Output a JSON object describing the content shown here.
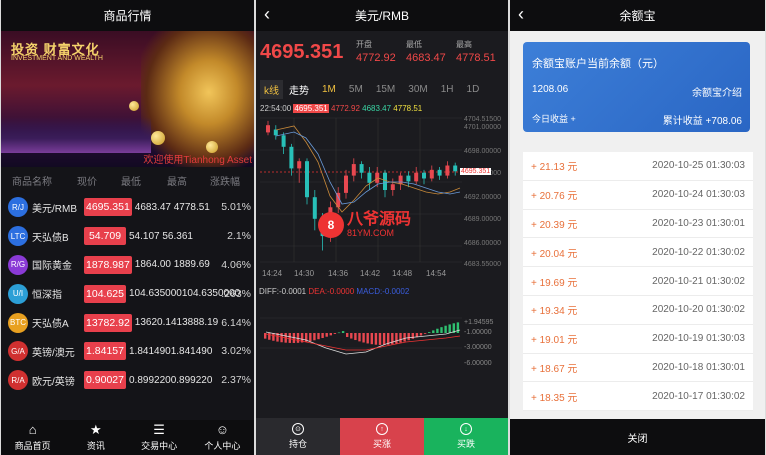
{
  "market": {
    "title": "商品行情",
    "banner": {
      "headline": "投资 财富文化",
      "sub": "INVESTMENT AND WEALTH",
      "welcome": "欢迎使用Tianhong Asset"
    },
    "columns": [
      "商品名称",
      "现价",
      "最低",
      "最高",
      "涨跌幅"
    ],
    "rows": [
      {
        "badge": "R/J",
        "name": "美元/RMB",
        "price": "4695.351",
        "vals": "4683.47 4778.51",
        "pct": "5.01%",
        "color": "#2c6fe0"
      },
      {
        "badge": "LTC",
        "name": "天弘债B",
        "price": "54.709",
        "vals": "54.107 56.361",
        "pct": "2.1%",
        "color": "#2c6fe0"
      },
      {
        "badge": "R/G",
        "name": "国际黄金",
        "price": "1878.987",
        "vals": "1864.00 1889.69",
        "pct": "4.06%",
        "color": "#8a3ad6"
      },
      {
        "badge": "U/I",
        "name": "恒深指",
        "price": "104.625",
        "vals": "104.635000104.6350000",
        "pct": ".263%",
        "color": "#2c9fd6"
      },
      {
        "badge": "BTC",
        "name": "天弘债A",
        "price": "13782.92",
        "vals": "13620.1413888.19",
        "pct": "6.14%",
        "color": "#e8a020"
      },
      {
        "badge": "G/A",
        "name": "英镑/澳元",
        "price": "1.84157",
        "vals": "1.8414901.841490",
        "pct": "3.02%",
        "color": "#d03030"
      },
      {
        "badge": "R/A",
        "name": "欧元/英镑",
        "price": "0.90027",
        "vals": "0.8992200.899220",
        "pct": "2.37%",
        "color": "#d03030"
      }
    ],
    "tabs": [
      {
        "icon": "⌂",
        "label": "商品首页"
      },
      {
        "icon": "★",
        "label": "资讯"
      },
      {
        "icon": "☰",
        "label": "交易中心"
      },
      {
        "icon": "☺",
        "label": "个人中心"
      }
    ]
  },
  "detail": {
    "title": "美元/RMB",
    "price": "4695.351",
    "open_label": "开盘",
    "open": "4772.92",
    "low_label": "最低",
    "low": "4683.47",
    "high_label": "最高",
    "high": "4778.51",
    "periods": {
      "kline": "k线",
      "trend": "走势",
      "p1": "1M",
      "p2": "5M",
      "p3": "15M",
      "p4": "30M",
      "p5": "1H",
      "p6": "1D"
    },
    "info": {
      "time": "22:54:00",
      "v1": "4695.351",
      "v2": "4772.92",
      "v3": "4683.47",
      "v4": "4778.51"
    },
    "yaxis": [
      "4704.51500",
      "4701.00000",
      "4698.00000",
      "4695.00000",
      "4692.00000",
      "4689.00000",
      "4686.00000",
      "4683.55000"
    ],
    "price_tag": "4695.351",
    "xaxis": [
      "14:24",
      "14:30",
      "14:36",
      "14:42",
      "14:48",
      "14:54"
    ],
    "macd": {
      "diff": "DIFF:-0.0001",
      "dea": "DEA:-0.0000",
      "m": "MACD:-0.0002"
    },
    "macd_axis": [
      "+1.94595",
      "-1.00000",
      "-3.00000",
      "-6.00000"
    ],
    "watermark": {
      "logo": "8",
      "name": "八爷源码",
      "site": "81YM.COM"
    },
    "actions": [
      {
        "icon": "⊙",
        "label": "持仓",
        "color": "#2a2a2e"
      },
      {
        "icon": "↑",
        "label": "买涨",
        "color": "#d8424c"
      },
      {
        "icon": "↓",
        "label": "买跌",
        "color": "#19b35d"
      }
    ]
  },
  "yuebao": {
    "title": "余额宝",
    "card": {
      "title": "余额宝账户当前余额（元）",
      "balance": "1208.06",
      "intro": "余额宝介绍",
      "today": "今日收益 +",
      "total": "累计收益 +708.06"
    },
    "records": [
      {
        "amount": "+ 21.13 元",
        "date": "2020-10-25 01:30:03"
      },
      {
        "amount": "+ 20.76 元",
        "date": "2020-10-24 01:30:03"
      },
      {
        "amount": "+ 20.39 元",
        "date": "2020-10-23 01:30:01"
      },
      {
        "amount": "+ 20.04 元",
        "date": "2020-10-22 01:30:02"
      },
      {
        "amount": "+ 19.69 元",
        "date": "2020-10-21 01:30:02"
      },
      {
        "amount": "+ 19.34 元",
        "date": "2020-10-20 01:30:02"
      },
      {
        "amount": "+ 19.01 元",
        "date": "2020-10-19 01:30:03"
      },
      {
        "amount": "+ 18.67 元",
        "date": "2020-10-18 01:30:01"
      },
      {
        "amount": "+ 18.35 元",
        "date": "2020-10-17 01:30:02"
      }
    ],
    "close": "关闭"
  }
}
